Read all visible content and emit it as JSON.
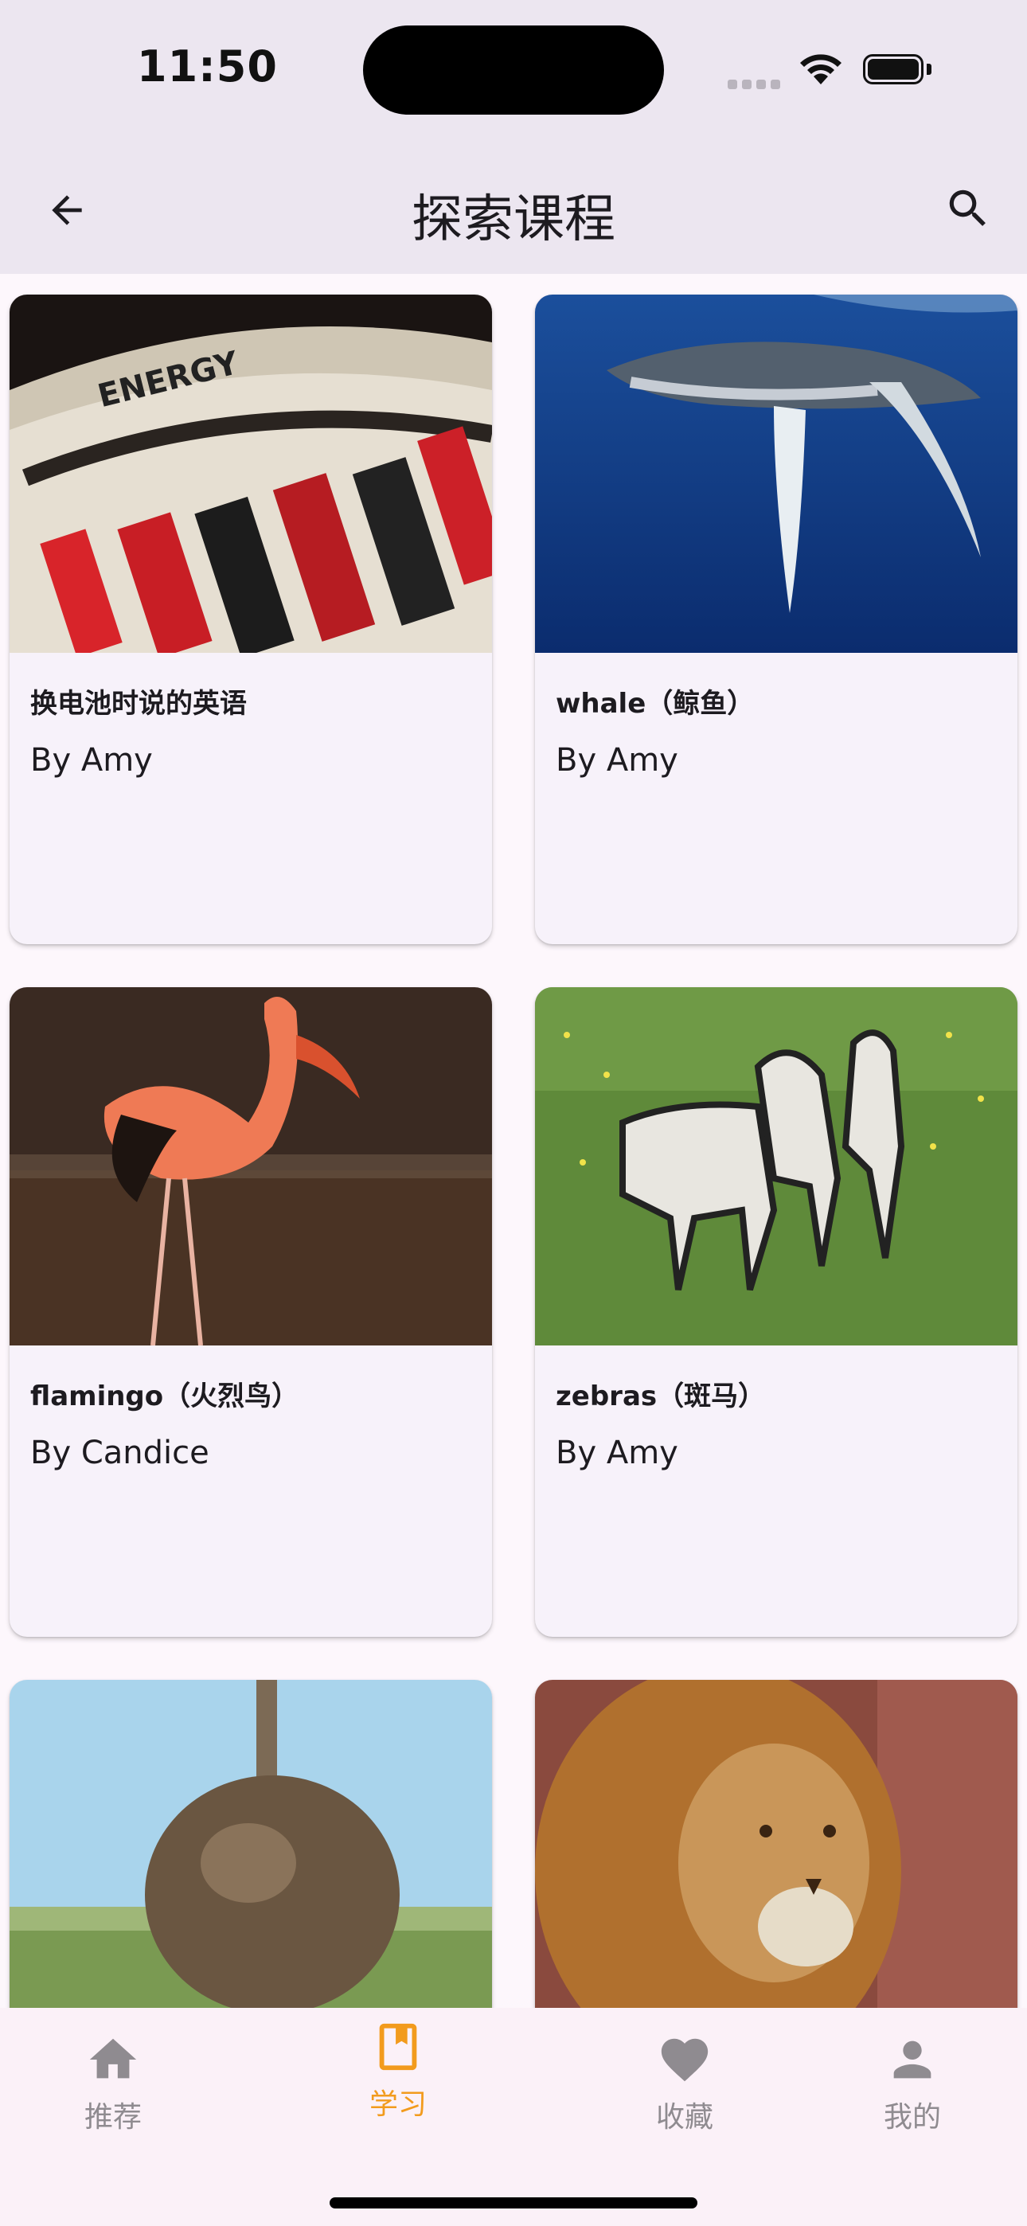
{
  "status_bar": {
    "time": "11:50"
  },
  "app_bar": {
    "title": "探索课程",
    "back_icon": "arrow-left-icon",
    "search_icon": "search-icon"
  },
  "courses": [
    {
      "title": "换电池时说的英语",
      "author": "By Amy",
      "image": "battery-charger-photo"
    },
    {
      "title": "whale（鲸鱼）",
      "author": "By Amy",
      "image": "humpback-whale-photo"
    },
    {
      "title": "flamingo（火烈鸟）",
      "author": "By Candice",
      "image": "flamingo-photo"
    },
    {
      "title": "zebras（斑马）",
      "author": "By Amy",
      "image": "zebras-photo"
    },
    {
      "title": "",
      "author": "",
      "image": "ostrich-photo"
    },
    {
      "title": "",
      "author": "",
      "image": "lion-photo"
    }
  ],
  "bottom_nav": {
    "items": [
      {
        "label": "推荐",
        "icon": "home-icon",
        "active": false
      },
      {
        "label": "学习",
        "icon": "book-icon",
        "active": true
      },
      {
        "label": "收藏",
        "icon": "heart-icon",
        "active": false
      },
      {
        "label": "我的",
        "icon": "person-icon",
        "active": false
      }
    ],
    "active_color": "#f29b1d",
    "inactive_color": "#8f8b90"
  }
}
